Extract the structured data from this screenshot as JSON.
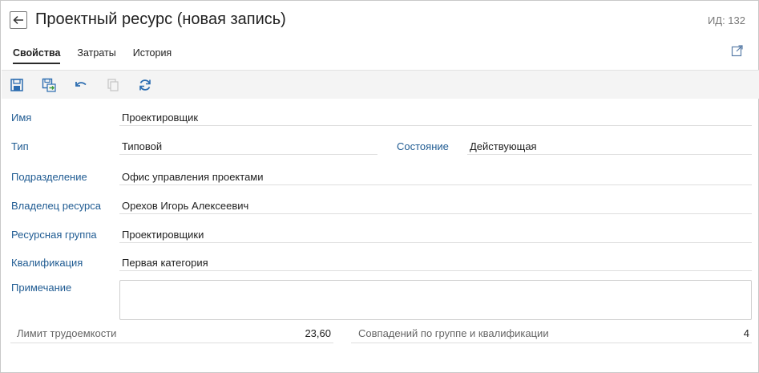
{
  "header": {
    "title": "Проектный ресурс (новая запись)",
    "record_id": "ИД: 132"
  },
  "tabs": [
    {
      "label": "Свойства",
      "active": true
    },
    {
      "label": "Затраты",
      "active": false
    },
    {
      "label": "История",
      "active": false
    }
  ],
  "toolbar": {
    "icons": [
      "save-icon",
      "save-and-close-icon",
      "undo-icon",
      "copy-icon",
      "refresh-icon"
    ]
  },
  "form": {
    "name": {
      "label": "Имя",
      "value": "Проектировщик"
    },
    "type": {
      "label": "Тип",
      "value": "Типовой"
    },
    "state": {
      "label": "Состояние",
      "value": "Действующая"
    },
    "department": {
      "label": "Подразделение",
      "value": "Офис управления проектами"
    },
    "owner": {
      "label": "Владелец ресурса",
      "value": "Орехов Игорь Алексеевич"
    },
    "resource_group": {
      "label": "Ресурсная группа",
      "value": "Проектировщики"
    },
    "qualification": {
      "label": "Квалификация",
      "value": "Первая категория"
    },
    "note": {
      "label": "Примечание",
      "value": ""
    }
  },
  "stats": {
    "labor_limit": {
      "label": "Лимит трудоемкости",
      "value": "23,60"
    },
    "matches": {
      "label": "Совпадений по группе и квалификации",
      "value": "4"
    }
  },
  "colors": {
    "label_blue": "#1f5b92",
    "toolbar_icon_blue": "#2b6cb0",
    "toolbar_bg": "#f4f4f4"
  }
}
